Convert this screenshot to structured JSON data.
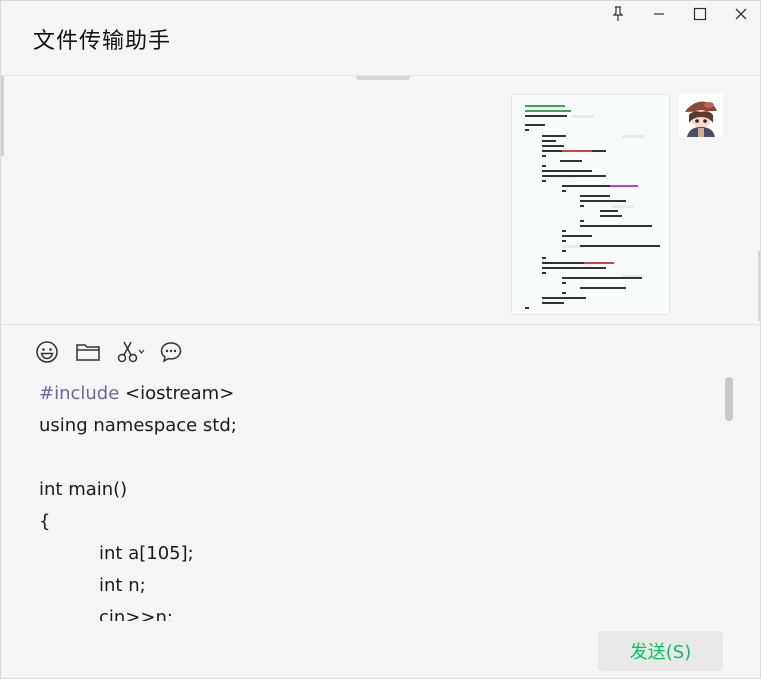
{
  "window": {
    "title": "文件传输助手"
  },
  "titlebar_buttons": [
    {
      "name": "pin-icon"
    },
    {
      "name": "minimize-icon"
    },
    {
      "name": "maximize-icon"
    },
    {
      "name": "close-icon"
    }
  ],
  "toolbar": {
    "items": [
      "emoji-icon",
      "folder-icon",
      "scissors-icon",
      "chat-bubble-icon"
    ]
  },
  "editor": {
    "lines": [
      {
        "pp": "#include",
        "rest": " <iostream>"
      },
      {
        "pp": "",
        "rest": "using namespace std;"
      },
      {
        "pp": "",
        "rest": ""
      },
      {
        "pp": "",
        "rest": "int main()"
      },
      {
        "pp": "",
        "rest": "{"
      },
      {
        "pp": "",
        "rest": "int a[105];"
      },
      {
        "pp": "",
        "rest": "int n;"
      },
      {
        "pp": "",
        "rest": "cin>>n;"
      }
    ]
  },
  "send_button": {
    "label": "发送(S)"
  },
  "colors": {
    "accent": "#07c160",
    "background": "#f5f5f5"
  }
}
